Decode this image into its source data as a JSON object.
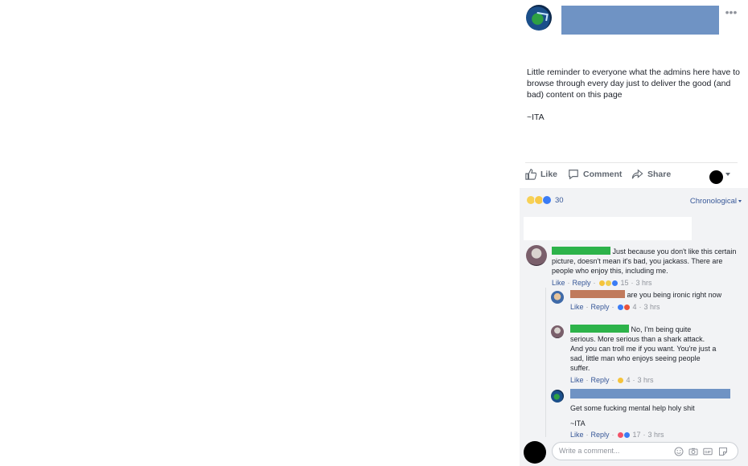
{
  "post": {
    "text": "Little reminder to everyone what the admins here have to browse through every day just to deliver the good (and bad) content on this page",
    "signature": "~ITA",
    "more_icon": "ellipsis-icon"
  },
  "actions": {
    "like": "Like",
    "comment": "Comment",
    "share": "Share"
  },
  "reactions": {
    "count": "30",
    "sort_label": "Chronological"
  },
  "comments": [
    {
      "text": "Just because you don't like this certain picture, doesn't mean it's bad, you jackass. There are people who enjoy this, including me.",
      "like": "Like",
      "reply": "Reply",
      "reaction_count": "15",
      "time": "3 hrs"
    }
  ],
  "replies": [
    {
      "text": "are you being ironic right now",
      "like": "Like",
      "reply": "Reply",
      "reaction_count": "4",
      "time": "3 hrs"
    },
    {
      "text": "No, I'm being quite serious. More serious than a shark attack. And you can troll me if you want. You're just a sad, little man who enjoys seeing people suffer.",
      "like": "Like",
      "reply": "Reply",
      "reaction_count": "4",
      "time": "3 hrs"
    },
    {
      "text": "Get some fucking mental help holy shit",
      "signature": "~ITA",
      "like": "Like",
      "reply": "Reply",
      "reaction_count": "17",
      "time": "3 hrs"
    }
  ],
  "composer": {
    "placeholder": "Write a comment..."
  },
  "colors": {
    "link": "#385898",
    "redaction_green": "#2db34a",
    "redaction_blue": "#6f93c4",
    "redaction_brown": "#c07a5c",
    "comments_bg": "#f2f3f5"
  }
}
